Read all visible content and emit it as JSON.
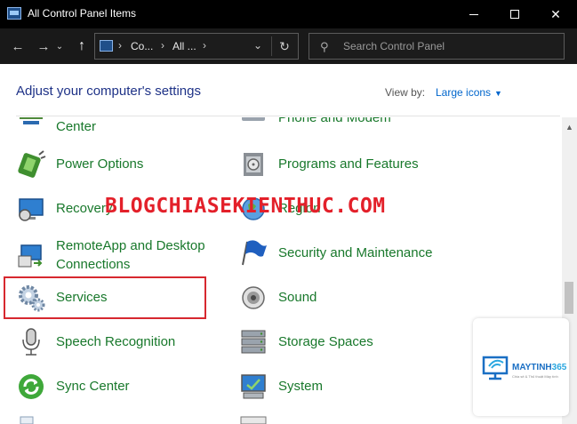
{
  "window": {
    "title": "All Control Panel Items",
    "minimize_symbol": "",
    "close_symbol": "✕"
  },
  "nav": {
    "back_symbol": "←",
    "forward_symbol": "→",
    "recent_symbol": "⌄",
    "up_symbol": "↑"
  },
  "address": {
    "crumb1": "Co...",
    "crumb2": "All ...",
    "sep_symbol": "›",
    "dropdown_symbol": "⌄",
    "refresh_symbol": "↻"
  },
  "search": {
    "placeholder": "Search Control Panel",
    "icon_symbol": "⚲"
  },
  "header": {
    "title": "Adjust your computer's settings",
    "view_by_label": "View by:",
    "view_by_value": "Large icons",
    "caret_symbol": "▼"
  },
  "items": [
    {
      "label": "Center",
      "icon": "network-sharing-center-icon"
    },
    {
      "label": "Phone and Modem",
      "icon": "phone-modem-icon"
    },
    {
      "label": "Power Options",
      "icon": "power-options-icon"
    },
    {
      "label": "Programs and Features",
      "icon": "programs-features-icon"
    },
    {
      "label": "Recovery",
      "icon": "recovery-icon"
    },
    {
      "label": "Region",
      "icon": "region-icon"
    },
    {
      "label_line1": "RemoteApp and Desktop",
      "label_line2": "Connections",
      "icon": "remoteapp-icon"
    },
    {
      "label": "Security and Maintenance",
      "icon": "security-maintenance-flag-icon"
    },
    {
      "label": "Services",
      "icon": "services-gear-icon"
    },
    {
      "label": "Sound",
      "icon": "sound-speaker-icon"
    },
    {
      "label": "Speech Recognition",
      "icon": "microphone-icon"
    },
    {
      "label": "Storage Spaces",
      "icon": "storage-spaces-icon"
    },
    {
      "label": "Sync Center",
      "icon": "sync-center-icon"
    },
    {
      "label": "System",
      "icon": "system-monitor-icon"
    }
  ],
  "overlay": {
    "watermark": "BLOGCHIASEKIENTHUC.COM",
    "logo_name": "MAYTINH",
    "logo_number": "365",
    "logo_tagline": "Chia sẻ & Thủ thuật Máy tính"
  },
  "scroll": {
    "up_symbol": "▲"
  },
  "colors": {
    "link_green": "#18782b",
    "title_blue": "#1e3287",
    "accent_blue": "#0066cc",
    "highlight_red": "#d7282f",
    "watermark_red": "#e3202a"
  }
}
